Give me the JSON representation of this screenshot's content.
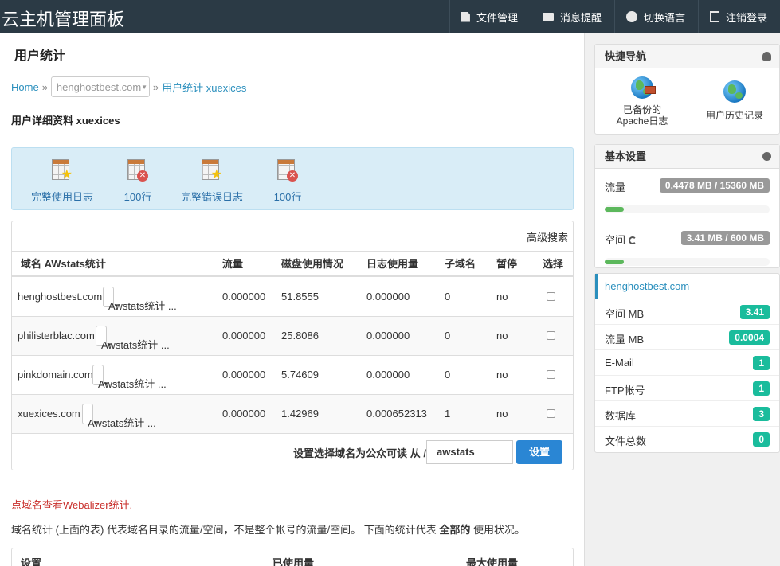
{
  "header": {
    "brand": "云主机管理面板",
    "nav": [
      {
        "icon": "file-icon",
        "label": "文件管理"
      },
      {
        "icon": "envelope-icon",
        "label": "消息提醒"
      },
      {
        "icon": "globe-icon",
        "label": "切换语言"
      },
      {
        "icon": "sign-out-icon",
        "label": "注销登录"
      }
    ]
  },
  "main": {
    "title": "用户统计",
    "breadcrumb": {
      "home": "Home",
      "separator": "»",
      "domain_select": "henghostbest.com",
      "current": "用户统计 xuexices"
    },
    "detail_title": "用户详细资料 xuexices",
    "log_links": [
      {
        "icon": "log-star-icon",
        "label": "完整使用日志"
      },
      {
        "icon": "log-delete-icon",
        "label": "100行"
      },
      {
        "icon": "log-star-icon",
        "label": "完整错误日志"
      },
      {
        "icon": "log-delete-icon",
        "label": "100行"
      }
    ],
    "table": {
      "advanced_search": "高级搜索",
      "headers": [
        "域名 AWstats统计",
        "流量",
        "磁盘使用情况",
        "日志使用量",
        "子域名",
        "暂停",
        "选择"
      ],
      "rows": [
        {
          "domain": "henghostbest.com",
          "stats": "Awstats统计 ...",
          "traffic": "0.000000",
          "disk": "51.8555",
          "log": "0.000000",
          "sub": "0",
          "pause": "no"
        },
        {
          "domain": "philisterblac.com",
          "stats": "Awstats统计 ...",
          "traffic": "0.000000",
          "disk": "25.8086",
          "log": "0.000000",
          "sub": "0",
          "pause": "no"
        },
        {
          "domain": "pinkdomain.com",
          "stats": "Awstats统计 ...",
          "traffic": "0.000000",
          "disk": "5.74609",
          "log": "0.000000",
          "sub": "0",
          "pause": "no"
        },
        {
          "domain": "xuexices.com",
          "stats": "Awstats统计 ...",
          "traffic": "0.000000",
          "disk": "1.42969",
          "log": "0.000652313",
          "sub": "1",
          "pause": "no"
        }
      ],
      "footer_label": "设置选择域名为公众可读 从 /",
      "footer_input": "awstats",
      "footer_button": "设置"
    },
    "red_note": "点域名查看Webalizer统计.",
    "info_note": {
      "before": "域名统计 (上面的表) 代表域名目录的流量/空间，不是整个帐号的流量/空间。 下面的统计代表 ",
      "bold": "全部的",
      "after": " 使用状况。"
    },
    "usage_headers": [
      "设置",
      "已使用量",
      "最大使用量"
    ]
  },
  "sidebar": {
    "quick_nav": {
      "title": "快捷导航",
      "items": [
        {
          "line1": "已备份的",
          "line2": "Apache日志"
        },
        {
          "line1": "用户历史记录",
          "line2": ""
        }
      ]
    },
    "basic_settings": {
      "title": "基本设置",
      "traffic_label": "流量",
      "traffic_value": "0.4478 MB / 15360 MB",
      "traffic_fraction": 3e-05,
      "space_label": "空间",
      "space_value": "3.41 MB / 600 MB",
      "space_fraction": 0.0057
    },
    "list": {
      "domain": "henghostbest.com",
      "items": [
        {
          "label": "空间 MB",
          "value": "3.41"
        },
        {
          "label": "流量 MB",
          "value": "0.0004"
        },
        {
          "label": "E-Mail",
          "value": "1"
        },
        {
          "label": "FTP帐号",
          "value": "1"
        },
        {
          "label": "数据库",
          "value": "3"
        },
        {
          "label": "文件总数",
          "value": "0"
        }
      ]
    }
  },
  "colors": {
    "topbar": "#2b3a45",
    "link": "#2a8fbd",
    "badge": "#1abc9c",
    "button": "#2a86d4",
    "progress": "#5cb85c",
    "note": "#c9302c"
  }
}
